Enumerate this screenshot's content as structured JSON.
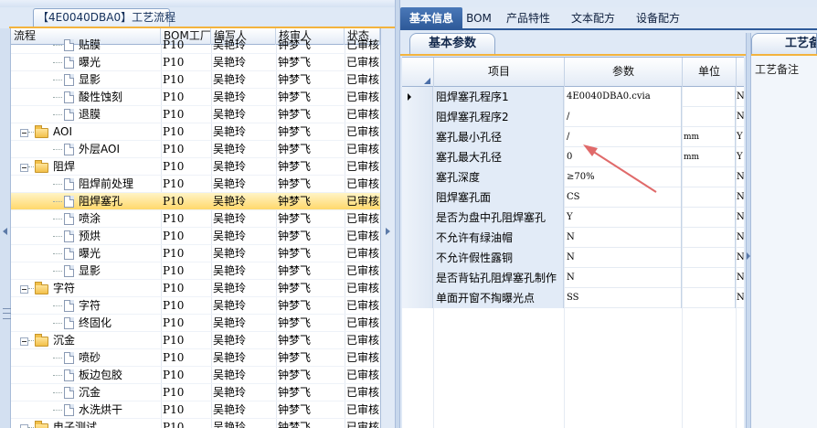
{
  "left": {
    "tab_title": "【4E0040DBA0】工艺流程",
    "columns": [
      "流程",
      "BOM工厂",
      "编写人",
      "核审人",
      "状态"
    ],
    "rows": [
      {
        "level": 2,
        "type": "file",
        "name": "贴膜",
        "bom": "P10",
        "editor": "吴艳玲",
        "reviewer": "钟梦飞",
        "status": "已审核"
      },
      {
        "level": 2,
        "type": "file",
        "name": "曝光",
        "bom": "P10",
        "editor": "吴艳玲",
        "reviewer": "钟梦飞",
        "status": "已审核"
      },
      {
        "level": 2,
        "type": "file",
        "name": "显影",
        "bom": "P10",
        "editor": "吴艳玲",
        "reviewer": "钟梦飞",
        "status": "已审核"
      },
      {
        "level": 2,
        "type": "file",
        "name": "酸性蚀刻",
        "bom": "P10",
        "editor": "吴艳玲",
        "reviewer": "钟梦飞",
        "status": "已审核"
      },
      {
        "level": 2,
        "type": "file",
        "name": "退膜",
        "bom": "P10",
        "editor": "吴艳玲",
        "reviewer": "钟梦飞",
        "status": "已审核"
      },
      {
        "level": 1,
        "type": "folder",
        "name": "AOI",
        "bom": "P10",
        "editor": "吴艳玲",
        "reviewer": "钟梦飞",
        "status": "已审核"
      },
      {
        "level": 2,
        "type": "file",
        "name": "外层AOI",
        "bom": "P10",
        "editor": "吴艳玲",
        "reviewer": "钟梦飞",
        "status": "已审核"
      },
      {
        "level": 1,
        "type": "folder",
        "name": "阻焊",
        "bom": "P10",
        "editor": "吴艳玲",
        "reviewer": "钟梦飞",
        "status": "已审核"
      },
      {
        "level": 2,
        "type": "file",
        "name": "阻焊前处理",
        "bom": "P10",
        "editor": "吴艳玲",
        "reviewer": "钟梦飞",
        "status": "已审核"
      },
      {
        "level": 2,
        "type": "file",
        "name": "阻焊塞孔",
        "bom": "P10",
        "editor": "吴艳玲",
        "reviewer": "钟梦飞",
        "status": "已审核",
        "selected": true
      },
      {
        "level": 2,
        "type": "file",
        "name": "喷涂",
        "bom": "P10",
        "editor": "吴艳玲",
        "reviewer": "钟梦飞",
        "status": "已审核"
      },
      {
        "level": 2,
        "type": "file",
        "name": "预烘",
        "bom": "P10",
        "editor": "吴艳玲",
        "reviewer": "钟梦飞",
        "status": "已审核"
      },
      {
        "level": 2,
        "type": "file",
        "name": "曝光",
        "bom": "P10",
        "editor": "吴艳玲",
        "reviewer": "钟梦飞",
        "status": "已审核"
      },
      {
        "level": 2,
        "type": "file",
        "name": "显影",
        "bom": "P10",
        "editor": "吴艳玲",
        "reviewer": "钟梦飞",
        "status": "已审核"
      },
      {
        "level": 1,
        "type": "folder",
        "name": "字符",
        "bom": "P10",
        "editor": "吴艳玲",
        "reviewer": "钟梦飞",
        "status": "已审核"
      },
      {
        "level": 2,
        "type": "file",
        "name": "字符",
        "bom": "P10",
        "editor": "吴艳玲",
        "reviewer": "钟梦飞",
        "status": "已审核"
      },
      {
        "level": 2,
        "type": "file",
        "name": "终固化",
        "bom": "P10",
        "editor": "吴艳玲",
        "reviewer": "钟梦飞",
        "status": "已审核"
      },
      {
        "level": 1,
        "type": "folder",
        "name": "沉金",
        "bom": "P10",
        "editor": "吴艳玲",
        "reviewer": "钟梦飞",
        "status": "已审核"
      },
      {
        "level": 2,
        "type": "file",
        "name": "喷砂",
        "bom": "P10",
        "editor": "吴艳玲",
        "reviewer": "钟梦飞",
        "status": "已审核"
      },
      {
        "level": 2,
        "type": "file",
        "name": "板边包胶",
        "bom": "P10",
        "editor": "吴艳玲",
        "reviewer": "钟梦飞",
        "status": "已审核"
      },
      {
        "level": 2,
        "type": "file",
        "name": "沉金",
        "bom": "P10",
        "editor": "吴艳玲",
        "reviewer": "钟梦飞",
        "status": "已审核"
      },
      {
        "level": 2,
        "type": "file",
        "name": "水洗烘干",
        "bom": "P10",
        "editor": "吴艳玲",
        "reviewer": "钟梦飞",
        "status": "已审核"
      },
      {
        "level": 1,
        "type": "folder",
        "name": "电子测试",
        "bom": "P10",
        "editor": "吴艳玲",
        "reviewer": "钟梦飞",
        "status": "已审核"
      }
    ]
  },
  "right": {
    "tabs": [
      "基本信息",
      "BOM",
      "产品特性",
      "文本配方",
      "设备配方"
    ],
    "active_tab": 0,
    "subtab": "基本参数",
    "columns": [
      "项目",
      "参数",
      "单位"
    ],
    "rows": [
      {
        "item": "阻焊塞孔程序1",
        "param": "4E0040DBA0.cvia",
        "unit": "",
        "extra": "N",
        "current": true
      },
      {
        "item": "阻焊塞孔程序2",
        "param": "/",
        "unit": "",
        "extra": "N"
      },
      {
        "item": "塞孔最小孔径",
        "param": "/",
        "unit": "mm",
        "extra": "Y"
      },
      {
        "item": "塞孔最大孔径",
        "param": "0",
        "unit": "mm",
        "extra": "Y"
      },
      {
        "item": "塞孔深度",
        "param": "≥70%",
        "unit": "",
        "extra": "N"
      },
      {
        "item": "阻焊塞孔面",
        "param": "CS",
        "unit": "",
        "extra": "N"
      },
      {
        "item": "是否为盘中孔阻焊塞孔",
        "param": "Y",
        "unit": "",
        "extra": "N"
      },
      {
        "item": "不允许有绿油帽",
        "param": "N",
        "unit": "",
        "extra": "N"
      },
      {
        "item": "不允许假性露铜",
        "param": "N",
        "unit": "",
        "extra": "N"
      },
      {
        "item": "是否背钻孔阻焊塞孔制作",
        "param": "N",
        "unit": "",
        "extra": "N"
      },
      {
        "item": "单面开窗不掏曝光点",
        "param": "SS",
        "unit": "",
        "extra": "N"
      }
    ],
    "remark_tab": "工艺备注",
    "remark_label": "工艺备注"
  },
  "colors": {
    "accent": "#2e5a99",
    "selected_row": "#ffd86b",
    "tab_underline": "#f3b33d",
    "annotation_arrow": "#e06a6a"
  }
}
